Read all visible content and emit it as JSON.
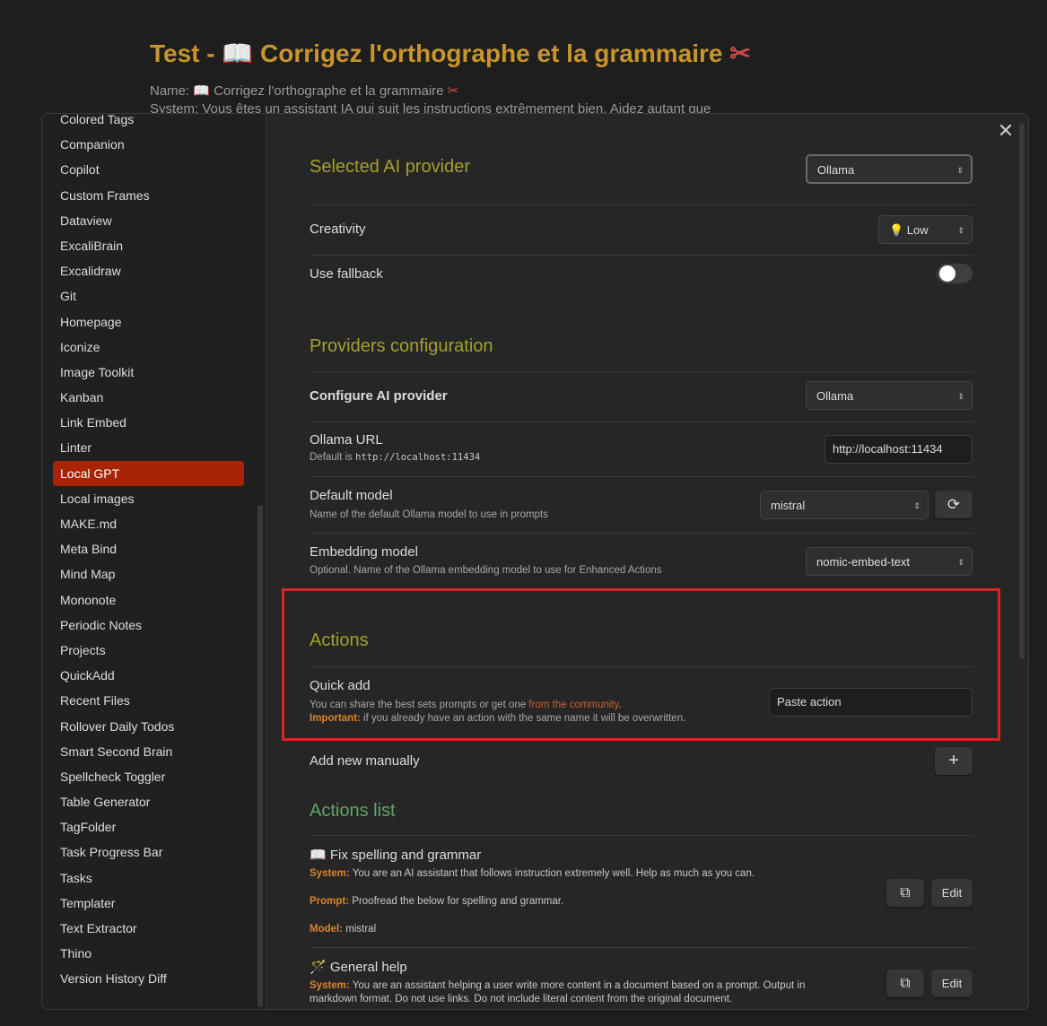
{
  "note": {
    "title_prefix": "Test - ",
    "title_icon": "📖",
    "title_text": " Corrigez l'orthographe et la grammaire ",
    "title_suffix_icon": "✂",
    "name_line": "Name: 📖 Corrigez l'orthographe et la grammaire ",
    "system_line": "System: Vous êtes un assistant IA qui suit les instructions extrêmement bien. Aidez autant que"
  },
  "sidebar": {
    "items": [
      "Colored Tags",
      "Companion",
      "Copilot",
      "Custom Frames",
      "Dataview",
      "ExcaliBrain",
      "Excalidraw",
      "Git",
      "Homepage",
      "Iconize",
      "Image Toolkit",
      "Kanban",
      "Link Embed",
      "Linter",
      "Local GPT",
      "Local images",
      "MAKE.md",
      "Meta Bind",
      "Mind Map",
      "Mononote",
      "Periodic Notes",
      "Projects",
      "QuickAdd",
      "Recent Files",
      "Rollover Daily Todos",
      "Smart Second Brain",
      "Spellcheck Toggler",
      "Table Generator",
      "TagFolder",
      "Task Progress Bar",
      "Tasks",
      "Templater",
      "Text Extractor",
      "Thino",
      "Version History Diff"
    ],
    "active": "Local GPT"
  },
  "settings": {
    "selected_provider_heading": "Selected AI provider",
    "selected_provider_value": "Ollama",
    "creativity_label": "Creativity",
    "creativity_value": "💡 Low",
    "use_fallback_label": "Use fallback",
    "use_fallback_on": false,
    "providers_heading": "Providers configuration",
    "configure_label": "Configure AI provider",
    "configure_value": "Ollama",
    "ollama_url_label": "Ollama URL",
    "ollama_url_desc_prefix": "Default is ",
    "ollama_url_desc_code": "http://localhost:11434",
    "ollama_url_value": "http://localhost:11434",
    "default_model_label": "Default model",
    "default_model_desc": "Name of the default Ollama model to use in prompts",
    "default_model_value": "mistral",
    "embedding_label": "Embedding model",
    "embedding_desc": "Optional. Name of the Ollama embedding model to use for Enhanced Actions",
    "embedding_value": "nomic-embed-text",
    "actions_heading": "Actions",
    "quick_add_label": "Quick add",
    "quick_add_desc_prefix": "You can share the best sets prompts or get one ",
    "quick_add_link": "from the community",
    "quick_add_desc_suffix": ".",
    "important_label": "Important:",
    "important_text": " if you already have an action with the same name it will be overwritten.",
    "paste_placeholder": "Paste action",
    "add_new_label": "Add new manually",
    "add_button": "+",
    "actions_list_heading": "Actions list"
  },
  "actions": [
    {
      "title": "📖 Fix spelling and grammar",
      "system_label": "System:",
      "system": " You are an AI assistant that follows instruction extremely well. Help as much as you can.",
      "prompt_label": "Prompt:",
      "prompt": " Proofread the below for spelling and grammar.",
      "model_label": "Model:",
      "model": " mistral",
      "edit": "Edit"
    },
    {
      "title": "🪄 General help",
      "system_label": "System:",
      "system_1": " You are an assistant helping a user write more content in a document based on a prompt. Output in",
      "system_2": "markdown format. Do not use links. Do not include literal content from the original document.",
      "edit": "Edit"
    }
  ],
  "colors": {
    "accent_active": "#a82405",
    "heading": "#a4a12c",
    "heading_green": "#62a468",
    "label_orange": "#d9862a",
    "highlight_box": "#d9261c"
  }
}
